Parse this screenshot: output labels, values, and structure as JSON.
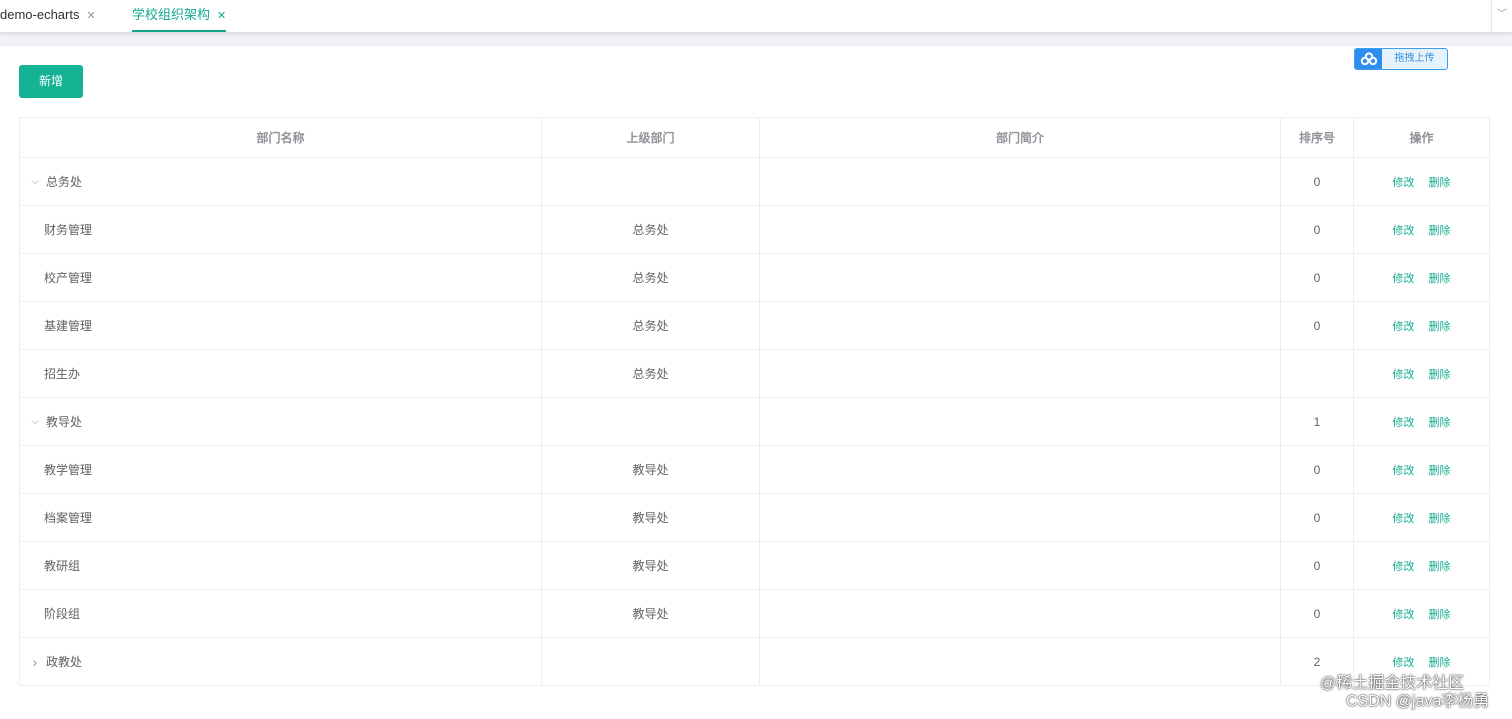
{
  "tabs": [
    {
      "label": "demo-echarts",
      "active": false
    },
    {
      "label": "学校组织架构",
      "active": true
    }
  ],
  "toolbar": {
    "add_label": "新增",
    "upload_label": "拖拽上传"
  },
  "table": {
    "columns": [
      "部门名称",
      "上级部门",
      "部门简介",
      "排序号",
      "操作"
    ],
    "actions": {
      "edit": "修改",
      "delete": "删除"
    },
    "rows": [
      {
        "name": "总务处",
        "parent": "",
        "desc": "",
        "order": "0",
        "level": 0,
        "expander": "down"
      },
      {
        "name": "财务管理",
        "parent": "总务处",
        "desc": "",
        "order": "0",
        "level": 1,
        "expander": ""
      },
      {
        "name": "校产管理",
        "parent": "总务处",
        "desc": "",
        "order": "0",
        "level": 1,
        "expander": ""
      },
      {
        "name": "基建管理",
        "parent": "总务处",
        "desc": "",
        "order": "0",
        "level": 1,
        "expander": ""
      },
      {
        "name": "招生办",
        "parent": "总务处",
        "desc": "",
        "order": "",
        "level": 1,
        "expander": ""
      },
      {
        "name": "教导处",
        "parent": "",
        "desc": "",
        "order": "1",
        "level": 0,
        "expander": "down"
      },
      {
        "name": "教学管理",
        "parent": "教导处",
        "desc": "",
        "order": "0",
        "level": 1,
        "expander": ""
      },
      {
        "name": "档案管理",
        "parent": "教导处",
        "desc": "",
        "order": "0",
        "level": 1,
        "expander": ""
      },
      {
        "name": "教研组",
        "parent": "教导处",
        "desc": "",
        "order": "0",
        "level": 1,
        "expander": ""
      },
      {
        "name": "阶段组",
        "parent": "教导处",
        "desc": "",
        "order": "0",
        "level": 1,
        "expander": ""
      },
      {
        "name": "政教处",
        "parent": "",
        "desc": "",
        "order": "2",
        "level": 0,
        "expander": "right"
      }
    ]
  },
  "watermark": {
    "line1": "@稀土掘金技术社区",
    "line2": "CSDN @java李杨勇"
  },
  "icons": {
    "tab_close": "close-icon",
    "tab_menu": "chevron-down-icon",
    "upload": "baidu-cloud-icon",
    "expand_down": "chevron-down-icon",
    "expand_right": "chevron-right-icon"
  },
  "colors": {
    "primary": "#13a88e",
    "add_button": "#13b394",
    "upload_accent": "#2f8df0"
  }
}
